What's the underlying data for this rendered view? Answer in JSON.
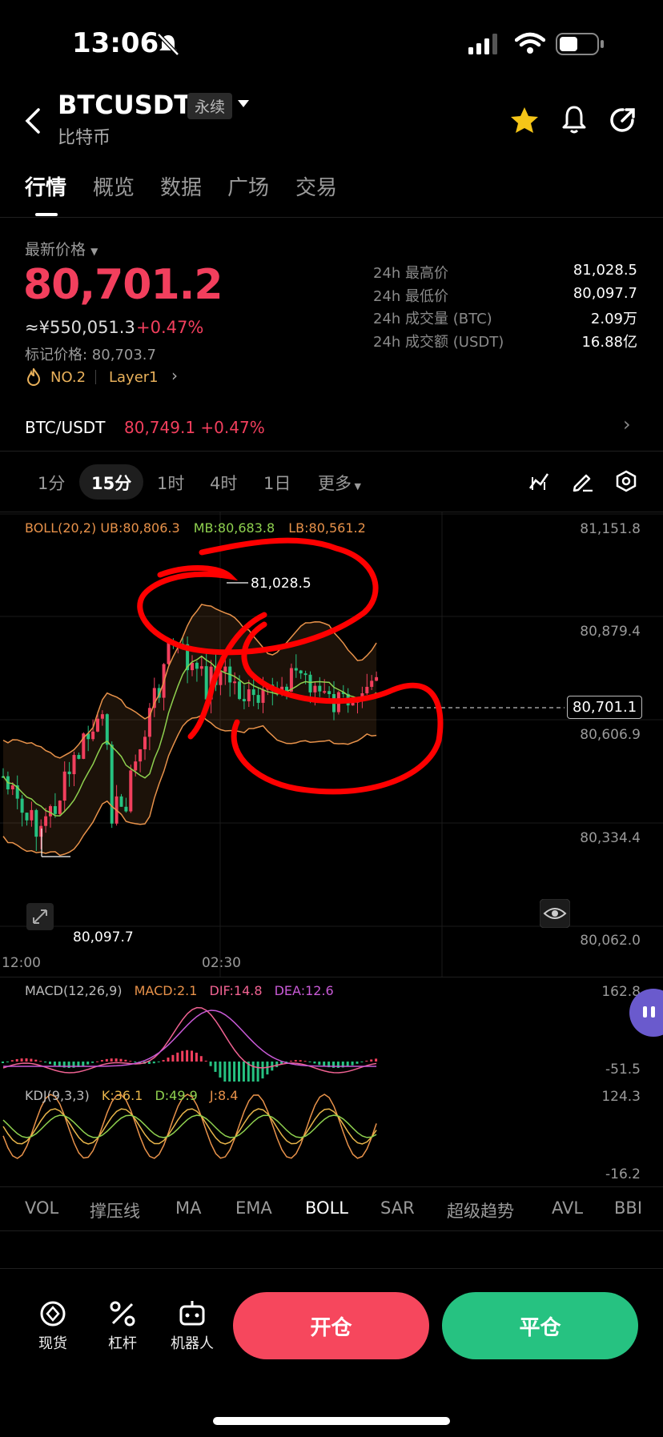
{
  "status": {
    "time": "13:06"
  },
  "header": {
    "symbol": "BTCUSDT",
    "badge": "永续",
    "name": "比特币"
  },
  "tabs": [
    "行情",
    "概览",
    "数据",
    "广场",
    "交易"
  ],
  "price": {
    "label": "最新价格",
    "last": "80,701.2",
    "cny": "≈¥550,051.3",
    "change": "+0.47%",
    "mark": "标记价格: 80,703.7",
    "rank": "NO.2",
    "layer": "Layer1"
  },
  "stats": [
    {
      "label": "24h 最高价",
      "value": "81,028.5"
    },
    {
      "label": "24h 最低价",
      "value": "80,097.7"
    },
    {
      "label": "24h 成交量 (BTC)",
      "value": "2.09万"
    },
    {
      "label": "24h 成交额 (USDT)",
      "value": "16.88亿"
    }
  ],
  "spot": {
    "pair": "BTC/USDT",
    "price": "80,749.1",
    "change": "+0.47%"
  },
  "intervals": [
    "1分",
    "15分",
    "1时",
    "4时",
    "1日",
    "更多"
  ],
  "active_interval": "15分",
  "chart": {
    "boll_name": "BOLL(20,2)",
    "ub": "UB:80,806.3",
    "mb": "MB:80,683.8",
    "lb": "LB:80,561.2",
    "y_ticks": [
      "81,151.8",
      "80,879.4",
      "80,606.9",
      "80,334.4",
      "80,062.0"
    ],
    "x_ticks": [
      "12:00",
      "02:30"
    ],
    "high_label": "81,028.5",
    "low_label": "80,097.7",
    "current": "80,701.1",
    "macd_name": "MACD(12,26,9)",
    "macd": "MACD:2.1",
    "dif": "DIF:14.8",
    "dea": "DEA:12.6",
    "macd_max": "162.8",
    "macd_min": "-51.5",
    "kdj_name": "KDJ(9,3,3)",
    "k": "K:36.1",
    "d": "D:49.9",
    "j": "J:8.4",
    "kdj_max": "124.3",
    "kdj_min": "-16.2",
    "colors": {
      "up": "#f23f5d",
      "down": "#26c281",
      "band": "#e8924a",
      "mid": "#8fd14f",
      "annotation": "#ff0000"
    }
  },
  "indicator_tabs": [
    "VOL",
    "撑压线",
    "MA",
    "EMA",
    "BOLL",
    "SAR",
    "超级趋势",
    "AVL",
    "BBI"
  ],
  "active_indicator": "BOLL",
  "bottom": {
    "spot": "现货",
    "leverage": "杠杆",
    "bot": "机器人",
    "open": "开仓",
    "close": "平仓"
  }
}
